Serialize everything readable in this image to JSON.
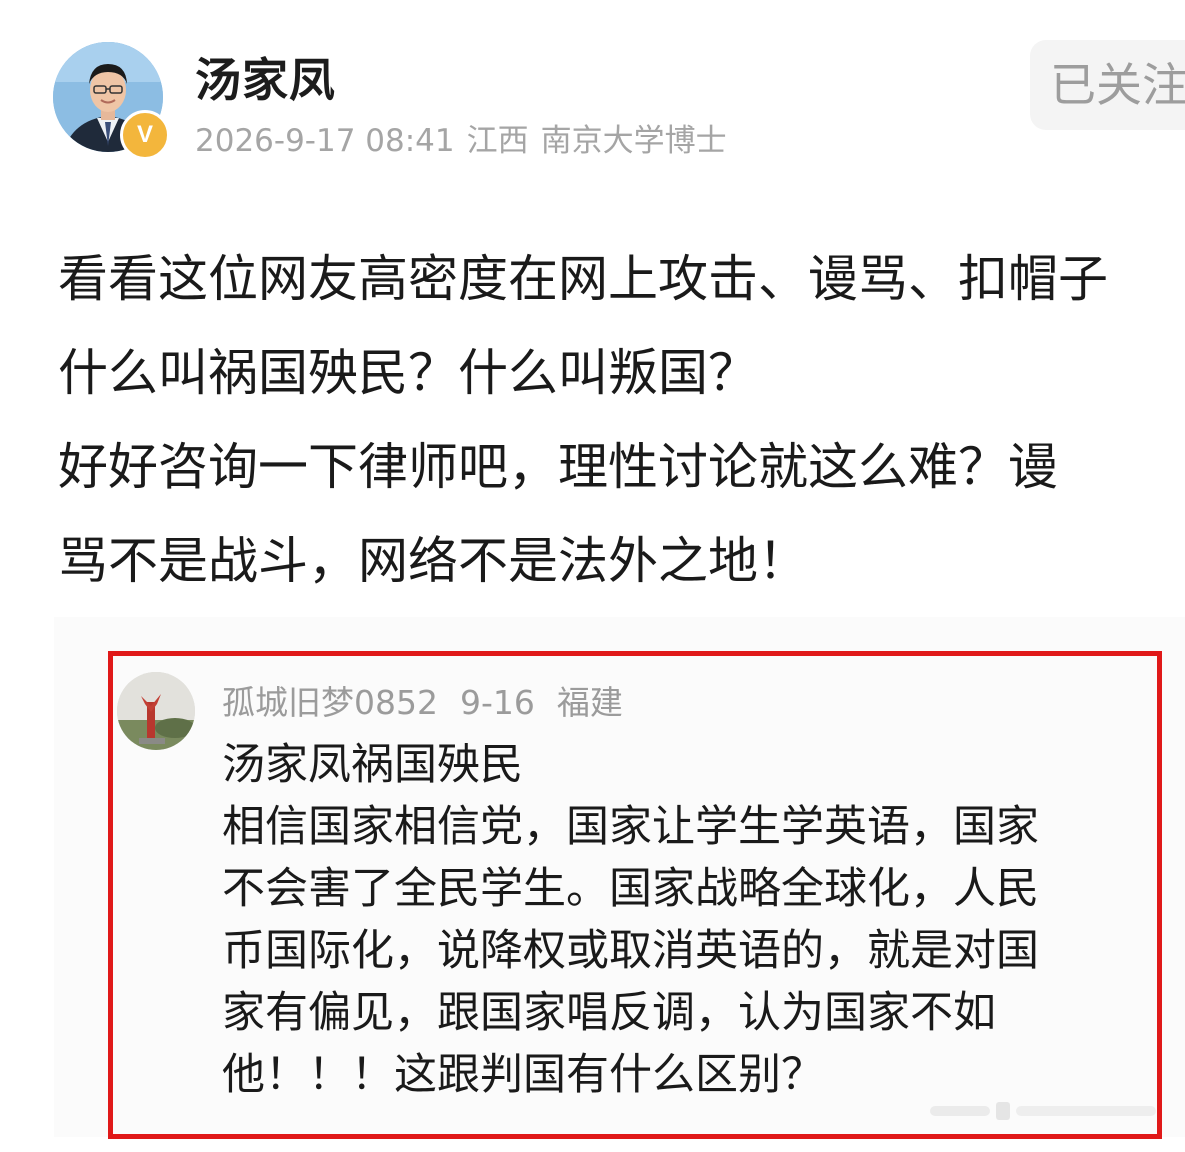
{
  "author": {
    "name": "汤家凤",
    "badge": "V",
    "time": "2026-9-17 08:41",
    "location": "江西",
    "tag": "南京大学博士"
  },
  "follow_button": {
    "label": "已关注"
  },
  "post": {
    "lines": [
      "看看这位网友高密度在网上攻击、谩骂、扣帽子",
      "什么叫祸国殃民？什么叫叛国？",
      "好好咨询一下律师吧，理性讨论就这么难？谩",
      "骂不是战斗，网络不是法外之地！"
    ]
  },
  "comment": {
    "username": "孤城旧梦0852",
    "date": "9-16",
    "location": "福建",
    "lines": [
      "汤家凤祸国殃民",
      "相信国家相信党，国家让学生学英语，国家",
      "不会害了全民学生。国家战略全球化，人民",
      "币国际化，说降权或取消英语的，就是对国",
      "家有偏见，跟国家唱反调，认为国家不如",
      "他！！！这跟判国有什么区别？"
    ]
  },
  "colors": {
    "highlight_border": "#e01919",
    "badge": "#f3b63c",
    "meta_text": "#a5a5a5"
  }
}
